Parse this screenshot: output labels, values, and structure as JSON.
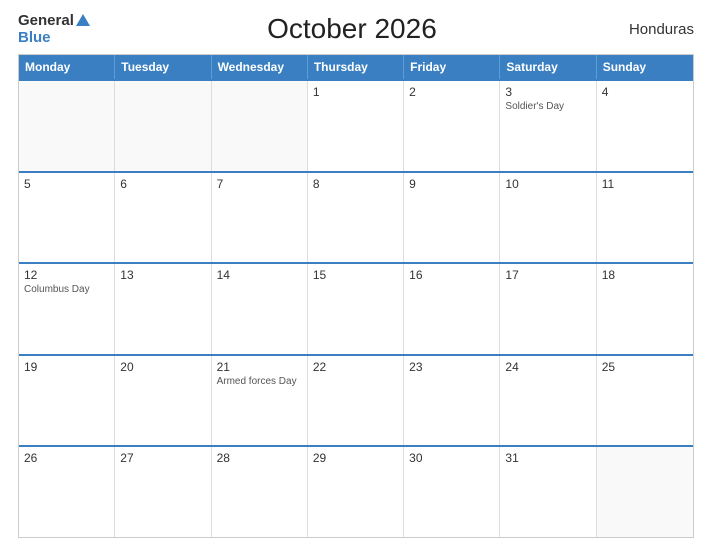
{
  "header": {
    "logo": {
      "general": "General",
      "blue": "Blue",
      "url_text": "GeneralBlue"
    },
    "title": "October 2026",
    "country": "Honduras"
  },
  "calendar": {
    "weekdays": [
      "Monday",
      "Tuesday",
      "Wednesday",
      "Thursday",
      "Friday",
      "Saturday",
      "Sunday"
    ],
    "weeks": [
      [
        {
          "day": "",
          "empty": true
        },
        {
          "day": "",
          "empty": true
        },
        {
          "day": "",
          "empty": true
        },
        {
          "day": "1",
          "holiday": ""
        },
        {
          "day": "2",
          "holiday": ""
        },
        {
          "day": "3",
          "holiday": "Soldier's Day"
        },
        {
          "day": "4",
          "holiday": ""
        }
      ],
      [
        {
          "day": "5",
          "holiday": ""
        },
        {
          "day": "6",
          "holiday": ""
        },
        {
          "day": "7",
          "holiday": ""
        },
        {
          "day": "8",
          "holiday": ""
        },
        {
          "day": "9",
          "holiday": ""
        },
        {
          "day": "10",
          "holiday": ""
        },
        {
          "day": "11",
          "holiday": ""
        }
      ],
      [
        {
          "day": "12",
          "holiday": "Columbus Day"
        },
        {
          "day": "13",
          "holiday": ""
        },
        {
          "day": "14",
          "holiday": ""
        },
        {
          "day": "15",
          "holiday": ""
        },
        {
          "day": "16",
          "holiday": ""
        },
        {
          "day": "17",
          "holiday": ""
        },
        {
          "day": "18",
          "holiday": ""
        }
      ],
      [
        {
          "day": "19",
          "holiday": ""
        },
        {
          "day": "20",
          "holiday": ""
        },
        {
          "day": "21",
          "holiday": "Armed forces Day"
        },
        {
          "day": "22",
          "holiday": ""
        },
        {
          "day": "23",
          "holiday": ""
        },
        {
          "day": "24",
          "holiday": ""
        },
        {
          "day": "25",
          "holiday": ""
        }
      ],
      [
        {
          "day": "26",
          "holiday": ""
        },
        {
          "day": "27",
          "holiday": ""
        },
        {
          "day": "28",
          "holiday": ""
        },
        {
          "day": "29",
          "holiday": ""
        },
        {
          "day": "30",
          "holiday": ""
        },
        {
          "day": "31",
          "holiday": ""
        },
        {
          "day": "",
          "empty": true
        }
      ]
    ]
  }
}
